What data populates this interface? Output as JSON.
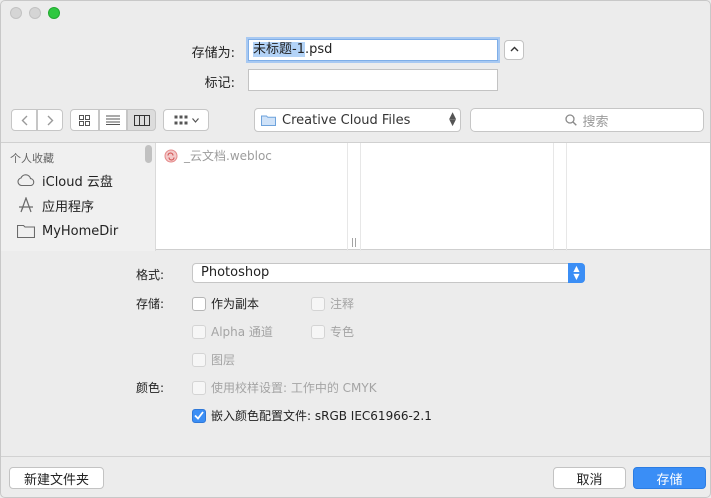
{
  "save_as": {
    "label": "存储为:",
    "value_selected": "未标题-1",
    "value_rest": ".psd"
  },
  "tags": {
    "label": "标记:",
    "value": ""
  },
  "toolbar": {
    "location": "Creative Cloud Files",
    "search_placeholder": "搜索"
  },
  "sidebar": {
    "header": "个人收藏",
    "items": [
      {
        "label": "iCloud 云盘",
        "icon": "cloud-icon"
      },
      {
        "label": "应用程序",
        "icon": "applications-icon"
      },
      {
        "label": "MyHomeDir",
        "icon": "folder-icon"
      }
    ]
  },
  "files": [
    {
      "name": "_云文档.webloc"
    }
  ],
  "options": {
    "format_label": "格式:",
    "format_value": "Photoshop",
    "save_label": "存储:",
    "color_label": "颜色:",
    "as_copy": "作为副本",
    "notes": "注释",
    "alpha": "Alpha 通道",
    "spot": "专色",
    "layers": "图层",
    "proof": "使用校样设置: 工作中的 CMYK",
    "embed_profile": "嵌入颜色配置文件: sRGB IEC61966-2.1"
  },
  "buttons": {
    "new_folder": "新建文件夹",
    "cancel": "取消",
    "save": "存储"
  },
  "colors": {
    "accent": "#3a8ef6",
    "close_light": "#d5d5d5",
    "zoom_light": "#2fc840"
  }
}
